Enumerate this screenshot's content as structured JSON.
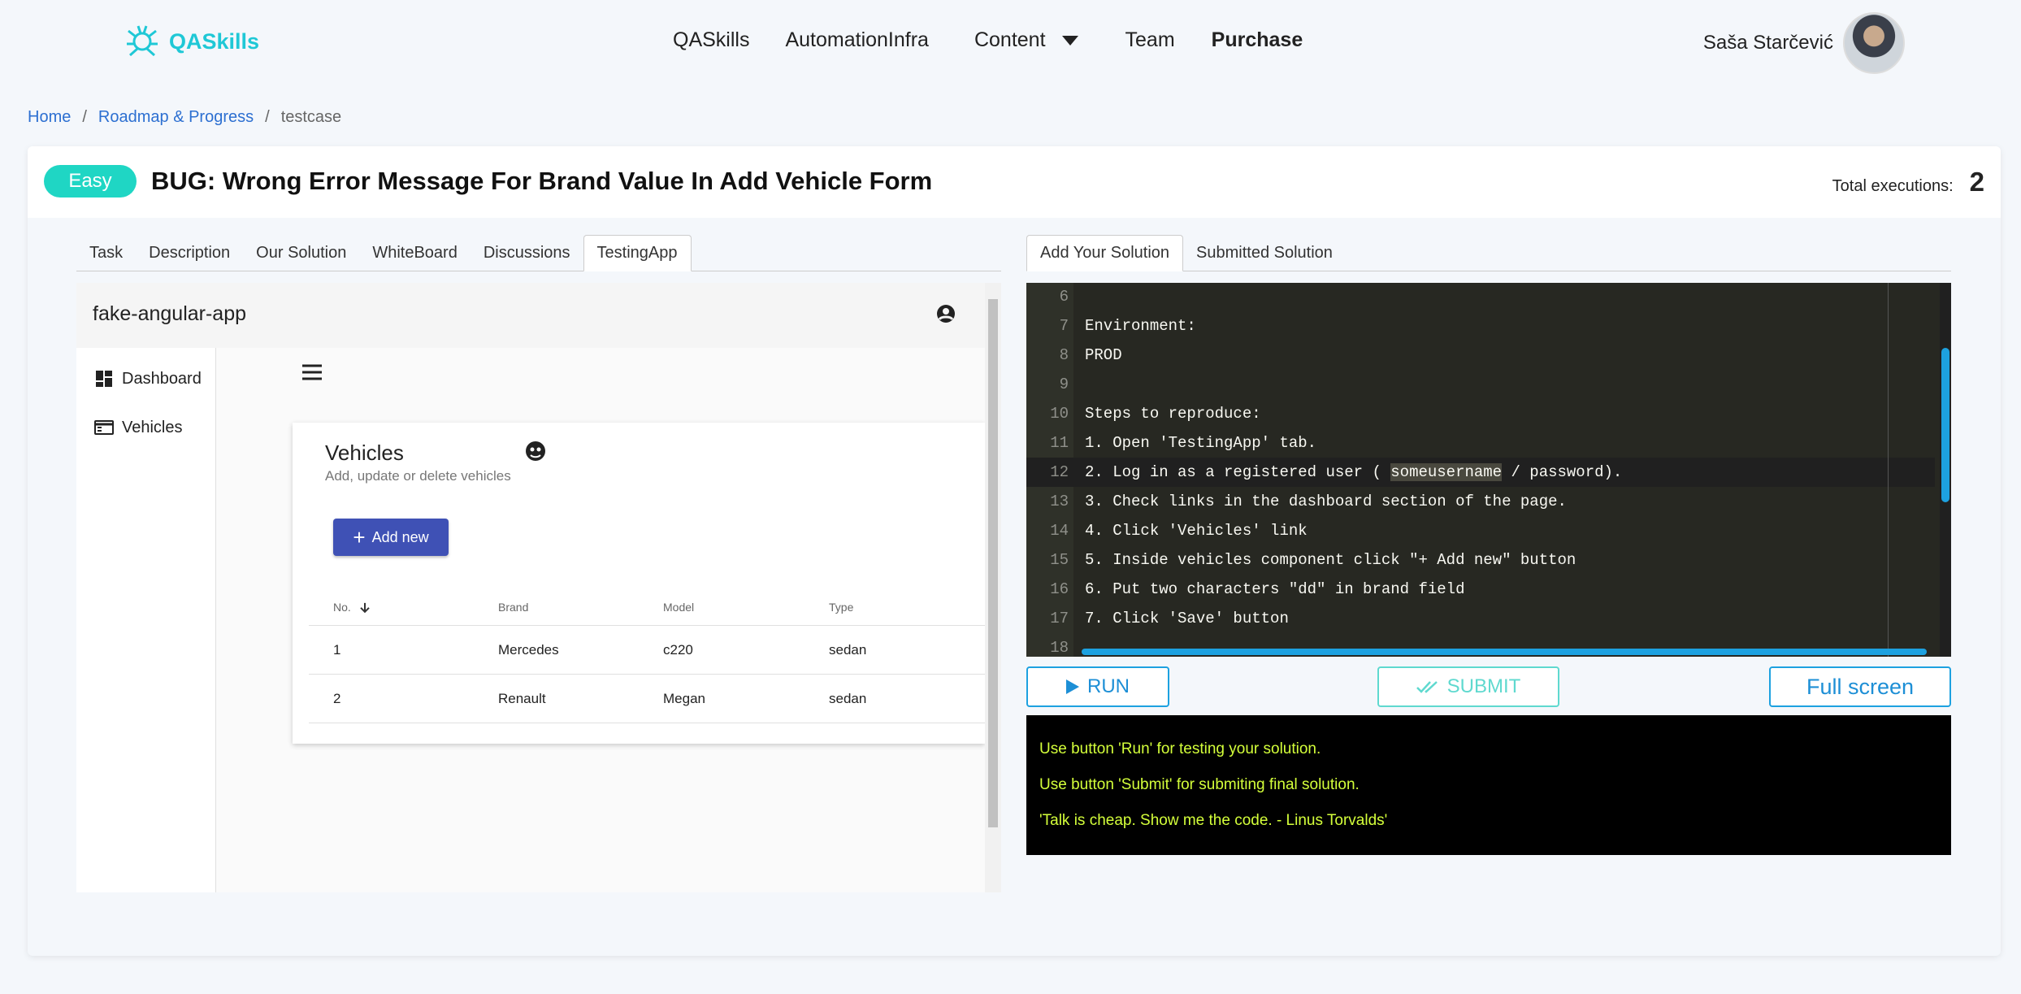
{
  "nav": {
    "brand": "QASkills",
    "links": [
      "QASkills",
      "AutomationInfra",
      "Content",
      "Team",
      "Purchase"
    ],
    "user_name": "Saša Starčević"
  },
  "breadcrumb": [
    "Home",
    "Roadmap & Progress",
    "testcase"
  ],
  "task": {
    "difficulty": "Easy",
    "title": "BUG: Wrong Error Message For Brand Value In Add Vehicle Form",
    "total_label": "Total executions:",
    "total_value": "2"
  },
  "left_tabs": [
    "Task",
    "Description",
    "Our Solution",
    "WhiteBoard",
    "Discussions",
    "TestingApp"
  ],
  "right_tabs": [
    "Add Your Solution",
    "Submitted Solution"
  ],
  "testing_app": {
    "title": "fake-angular-app",
    "sidebar": [
      "Dashboard",
      "Vehicles"
    ],
    "card_title": "Vehicles",
    "card_subtitle": "Add, update or delete vehicles",
    "add_button": "Add new",
    "columns": [
      "No.",
      "Brand",
      "Model",
      "Type"
    ],
    "rows": [
      [
        "1",
        "Mercedes",
        "c220",
        "sedan"
      ],
      [
        "2",
        "Renault",
        "Megan",
        "sedan"
      ]
    ]
  },
  "editor": {
    "lines": [
      {
        "n": "6",
        "text": ""
      },
      {
        "n": "7",
        "text": "Environment:"
      },
      {
        "n": "8",
        "text": "PROD"
      },
      {
        "n": "9",
        "text": ""
      },
      {
        "n": "10",
        "text": "Steps to reproduce:"
      },
      {
        "n": "11",
        "text": "1. Open 'TestingApp' tab."
      },
      {
        "n": "12",
        "pre": "2. Log in as a registered user ( ",
        "hl": "someusername",
        "post": " / password)."
      },
      {
        "n": "13",
        "text": "3. Check links in the dashboard section of the page."
      },
      {
        "n": "14",
        "text": "4. Click 'Vehicles' link"
      },
      {
        "n": "15",
        "text": "5. Inside vehicles component click \"+ Add new\" button"
      },
      {
        "n": "16",
        "text": "6. Put two characters \"dd\" in brand field"
      },
      {
        "n": "17",
        "text": "7. Click 'Save' button"
      },
      {
        "n": "18",
        "text": ""
      }
    ]
  },
  "buttons": {
    "run": "RUN",
    "submit": "SUBMIT",
    "fullscreen": "Full screen"
  },
  "console": [
    "Use button 'Run' for testing your solution.",
    "Use button 'Submit' for submiting final solution.",
    "'Talk is cheap. Show me the code. - Linus Torvalds'"
  ],
  "colors": {
    "accent": "#1fc8d6",
    "link": "#2c6fd1",
    "primary_button": "#3f51b5",
    "console_text": "#d4ff3a",
    "editor_bg": "#272822"
  }
}
